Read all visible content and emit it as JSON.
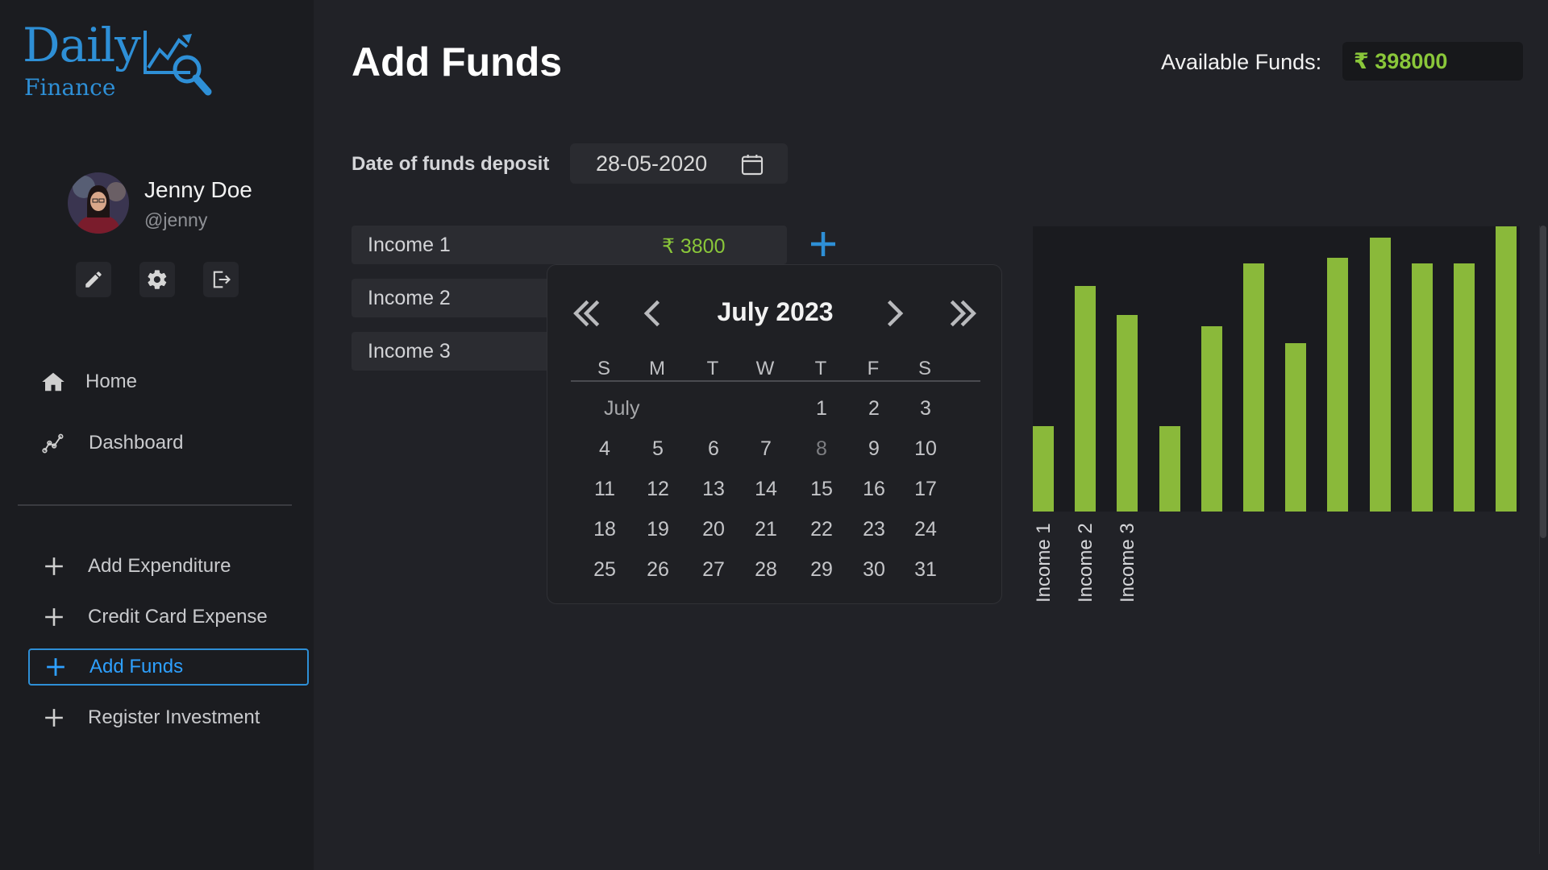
{
  "brand": {
    "name_top": "Daily",
    "name_bottom": "Finance"
  },
  "user": {
    "name": "Jenny Doe",
    "handle": "@jenny"
  },
  "nav": [
    {
      "label": "Home",
      "icon": "home-icon"
    },
    {
      "label": "Dashboard",
      "icon": "dashboard-icon"
    }
  ],
  "menu": [
    {
      "label": "Add Expenditure",
      "active": false
    },
    {
      "label": "Credit Card Expense",
      "active": false
    },
    {
      "label": "Add Funds",
      "active": true
    },
    {
      "label": "Register Investment",
      "active": false
    }
  ],
  "page": {
    "title": "Add Funds",
    "available_label": "Available Funds:",
    "available_value": "₹ 398000",
    "date_label": "Date of funds deposit",
    "date_value": "28-05-2020"
  },
  "incomes": [
    {
      "label": "Income 1",
      "amount": "₹ 3800"
    },
    {
      "label": "Income 2",
      "amount": ""
    },
    {
      "label": "Income 3",
      "amount": ""
    }
  ],
  "calendar": {
    "title": "July 2023",
    "month_label": "July",
    "weekdays": [
      "S",
      "M",
      "T",
      "W",
      "T",
      "F",
      "S"
    ],
    "muted_day": "8"
  },
  "colors": {
    "accent": "#2e8fd6",
    "money": "#8ac73a",
    "bar": "#8ab93a"
  },
  "chart_data": {
    "type": "bar",
    "categories": [
      "Income 1",
      "Income 2",
      "Income 3",
      "",
      "",
      "",
      "",
      "",
      "",
      "",
      "",
      ""
    ],
    "values": [
      30,
      79,
      69,
      30,
      65,
      87,
      59,
      89,
      96,
      87,
      87,
      100
    ],
    "ylim": [
      0,
      100
    ],
    "grid": false
  }
}
